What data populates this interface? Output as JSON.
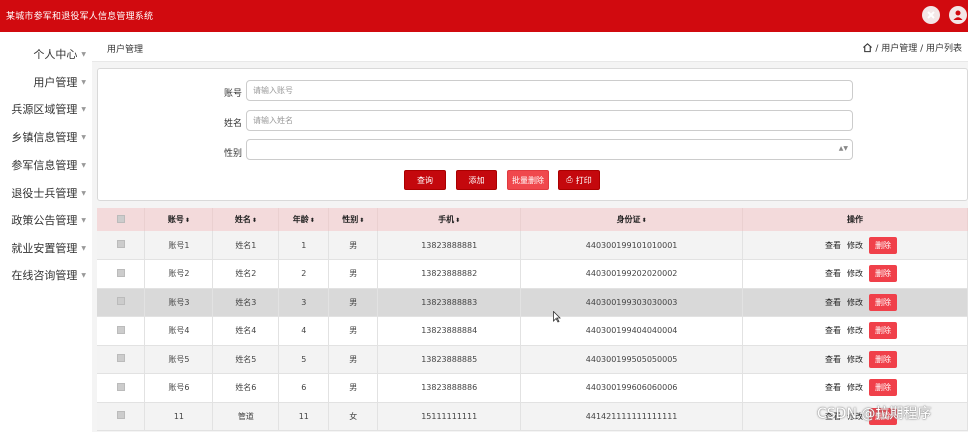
{
  "header": {
    "app_title": "某城市参军和退役军人信息管理系统"
  },
  "sidebar": {
    "items": [
      {
        "label": "个人中心"
      },
      {
        "label": "用户管理"
      },
      {
        "label": "兵源区域管理"
      },
      {
        "label": "乡镇信息管理"
      },
      {
        "label": "参军信息管理"
      },
      {
        "label": "退役士兵管理"
      },
      {
        "label": "政策公告管理"
      },
      {
        "label": "就业安置管理"
      },
      {
        "label": "在线咨询管理"
      }
    ]
  },
  "page": {
    "title": "用户管理",
    "breadcrumb": "/ 用户管理 / 用户列表"
  },
  "search": {
    "account_label": "账号",
    "account_placeholder": "请输入账号",
    "name_label": "姓名",
    "name_placeholder": "请输入姓名",
    "gender_label": "性别"
  },
  "buttons": {
    "query": "查询",
    "add": "添加",
    "batch_delete": "批量删除",
    "print": "打印"
  },
  "table": {
    "headers": {
      "account": "账号",
      "name": "姓名",
      "age": "年龄",
      "gender": "性别",
      "phone": "手机",
      "idcard": "身份证",
      "ops": "操作"
    },
    "rows": [
      {
        "account": "账号1",
        "name": "姓名1",
        "age": "1",
        "gender": "男",
        "phone": "13823888881",
        "idcard": "440300199101010001"
      },
      {
        "account": "账号2",
        "name": "姓名2",
        "age": "2",
        "gender": "男",
        "phone": "13823888882",
        "idcard": "440300199202020002"
      },
      {
        "account": "账号3",
        "name": "姓名3",
        "age": "3",
        "gender": "男",
        "phone": "13823888883",
        "idcard": "440300199303030003"
      },
      {
        "account": "账号4",
        "name": "姓名4",
        "age": "4",
        "gender": "男",
        "phone": "13823888884",
        "idcard": "440300199404040004"
      },
      {
        "account": "账号5",
        "name": "姓名5",
        "age": "5",
        "gender": "男",
        "phone": "13823888885",
        "idcard": "440300199505050005"
      },
      {
        "account": "账号6",
        "name": "姓名6",
        "age": "6",
        "gender": "男",
        "phone": "13823888886",
        "idcard": "440300199606060006"
      },
      {
        "account": "11",
        "name": "管道",
        "age": "11",
        "gender": "女",
        "phone": "15111111111",
        "idcard": "441421111111111111"
      }
    ],
    "op_view": "查看",
    "op_edit": "修改",
    "op_delete": "删除"
  },
  "watermark": "CSDN @拉期程序",
  "colors": {
    "brand": "#d10a0f",
    "delete": "#f0404a"
  },
  "icons": [
    "close-icon",
    "user-icon",
    "home-icon",
    "print-icon",
    "chevron-down-icon"
  ]
}
